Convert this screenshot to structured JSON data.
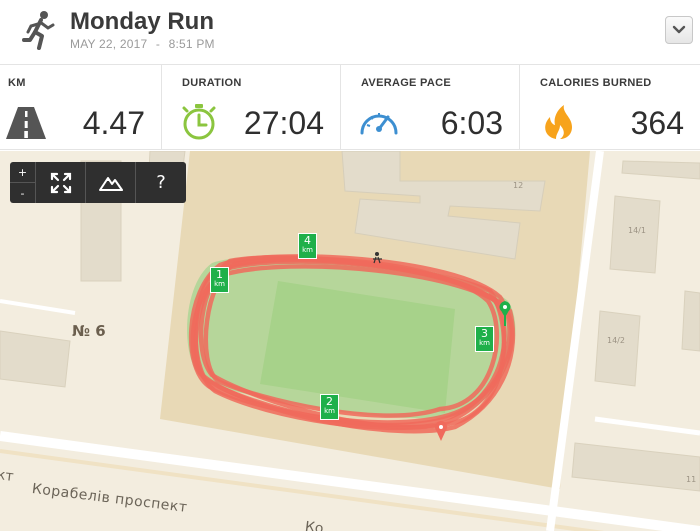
{
  "header": {
    "title": "Monday Run",
    "date": "MAY 22, 2017",
    "separator": "-",
    "time": "8:51 PM",
    "activity_icon": "runner-icon",
    "dropdown_icon": "chevron-down-icon"
  },
  "stats": [
    {
      "label": "KM",
      "value": "4.47",
      "icon": "road-icon"
    },
    {
      "label": "DURATION",
      "value": "27:04",
      "icon": "stopwatch-icon"
    },
    {
      "label": "AVERAGE PACE",
      "value": "6:03",
      "icon": "speedometer-icon"
    },
    {
      "label": "CALORIES BURNED",
      "value": "364",
      "icon": "flame-icon"
    }
  ],
  "map": {
    "toolbar": {
      "zoom_in": "+",
      "zoom_out": "-",
      "fullscreen_icon": "expand-icon",
      "terrain_icon": "mountain-icon",
      "help": "?"
    },
    "labels": {
      "area": "№ 6",
      "street": "Корабелів проспект",
      "street_left_fragment": "кт",
      "street_bottom_fragment": "Ко"
    },
    "building_numbers": [
      "12",
      "14/1",
      "14/2",
      "11"
    ],
    "km_markers": [
      {
        "number": "1",
        "unit": "km"
      },
      {
        "number": "2",
        "unit": "km"
      },
      {
        "number": "3",
        "unit": "km"
      },
      {
        "number": "4",
        "unit": "km"
      }
    ],
    "colors": {
      "route": "#f06a5c",
      "marker": "#1fb04a",
      "start_pin": "#1fb04a",
      "end_pin": "#f06a5c"
    }
  }
}
